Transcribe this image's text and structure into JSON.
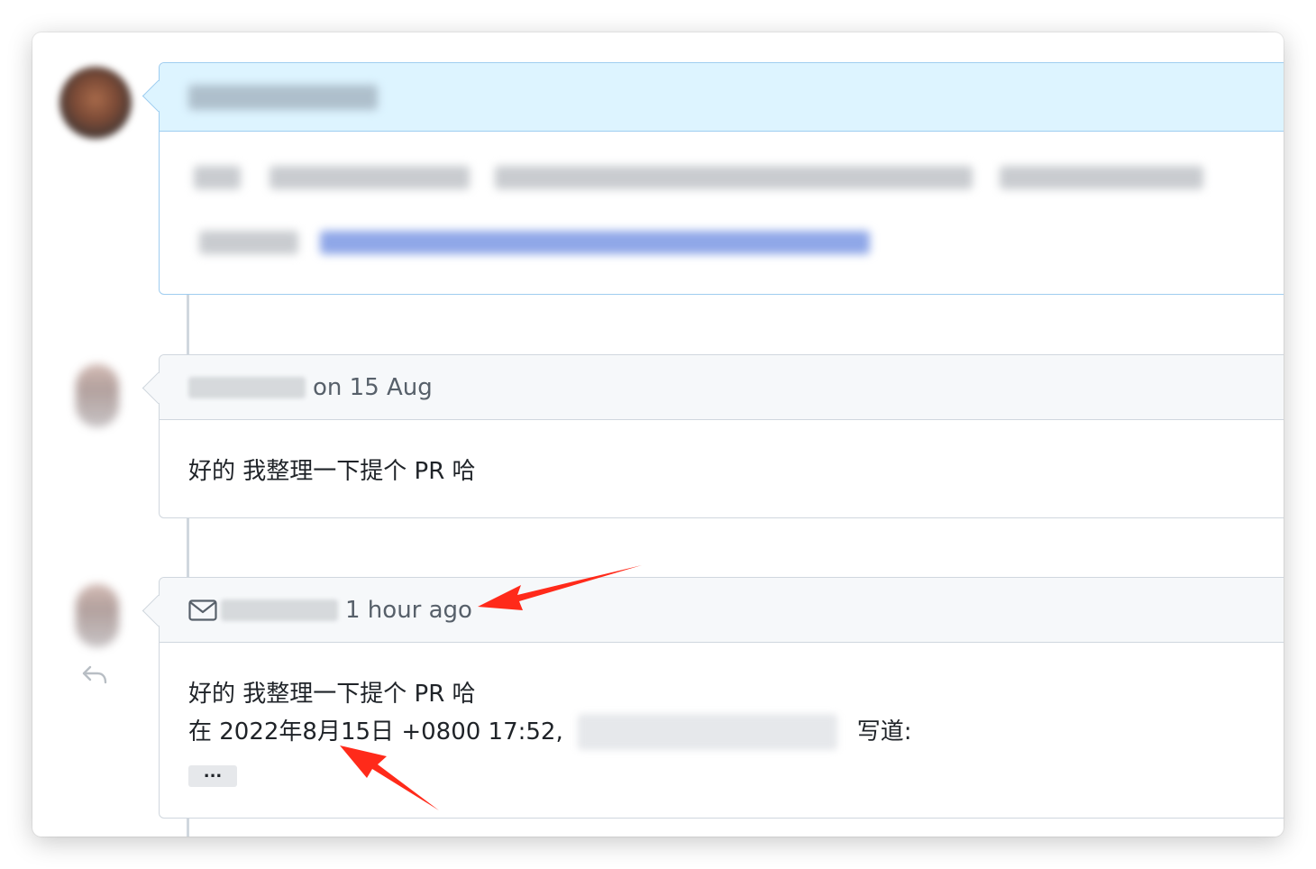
{
  "comments": [
    {
      "header_text": "",
      "body_text": "",
      "accent_color": "#ddf4ff"
    },
    {
      "header_text": "on 15 Aug",
      "body_text": "好的 我整理一下提个 PR 哈"
    },
    {
      "header_icon": "mail-icon",
      "header_text": "1 hour ago",
      "body_line_1": "好的 我整理一下提个 PR 哈",
      "body_date": "在 2022年8月15日 +0800 17:52,",
      "body_wrote": "写道:",
      "ellipsis_label": "...",
      "reply_icon": "reply-icon"
    }
  ],
  "annotations": {
    "arrow_color": "#ff2a1a"
  }
}
